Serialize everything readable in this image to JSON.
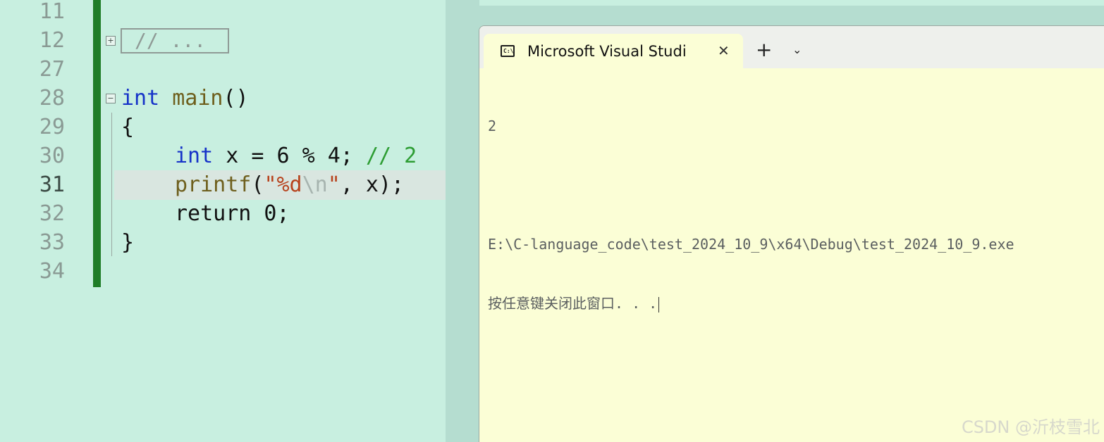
{
  "editor": {
    "gutter": [
      "11",
      "12",
      "27",
      "28",
      "29",
      "30",
      "31",
      "32",
      "33",
      "34"
    ],
    "current_line": "31",
    "collapsed_region_label": "// ...",
    "fold_expand_glyph": "+",
    "fold_collapse_glyph": "−",
    "code": {
      "l28_kw": "int",
      "l28_fn": "main",
      "l28_rest": "()",
      "l29": "{",
      "l30_kw": "int",
      "l30_rest": " x = 6 % 4; ",
      "l30_comment": "// 2",
      "l31_fn": "printf",
      "l31_open": "(",
      "l31_str": "\"%d",
      "l31_esc": "\\n",
      "l31_strend": "\"",
      "l31_rest": ", x);",
      "l32": "return 0;",
      "l33": "}"
    }
  },
  "terminal": {
    "tab_title": "Microsoft Visual Studi",
    "tab_close_glyph": "✕",
    "tab_icon_text": "C:\\",
    "new_tab_glyph": "+",
    "dropdown_glyph": "⌄",
    "output": {
      "line1": "2",
      "line2": "E:\\C-language_code\\test_2024_10_9\\x64\\Debug\\test_2024_10_9.exe",
      "line3": "按任意键关闭此窗口. . ."
    }
  },
  "watermark": "CSDN @沂枝雪北"
}
